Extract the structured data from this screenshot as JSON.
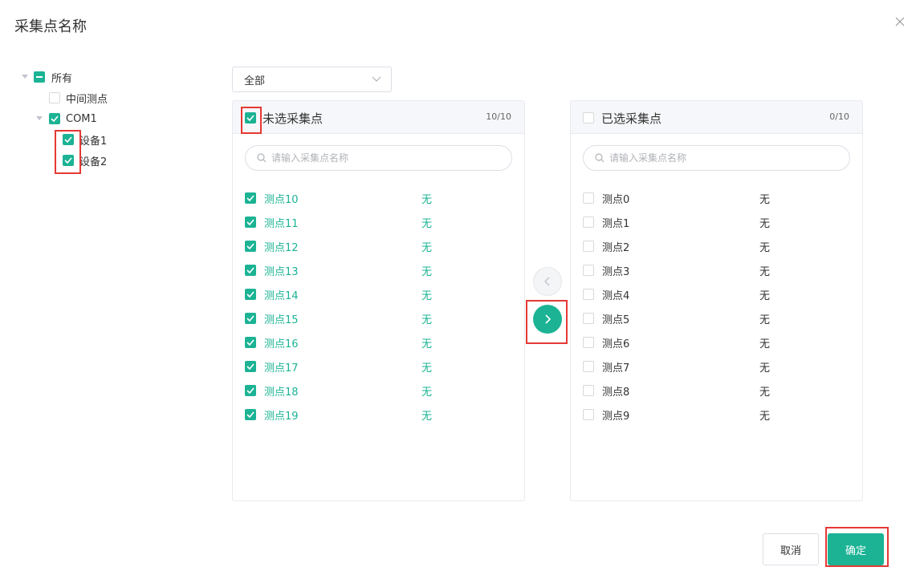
{
  "dialog": {
    "title": "采集点名称"
  },
  "tree": {
    "all_label": "所有",
    "mid_label": "中间测点",
    "com_label": "COM1",
    "device1_label": "设备1",
    "device2_label": "设备2"
  },
  "filter": {
    "selected": "全部"
  },
  "left_panel": {
    "title": "未选采集点",
    "count": "10/10",
    "search_placeholder": "请输入采集点名称",
    "items": [
      {
        "label": "测点10",
        "value": "无"
      },
      {
        "label": "测点11",
        "value": "无"
      },
      {
        "label": "测点12",
        "value": "无"
      },
      {
        "label": "测点13",
        "value": "无"
      },
      {
        "label": "测点14",
        "value": "无"
      },
      {
        "label": "测点15",
        "value": "无"
      },
      {
        "label": "测点16",
        "value": "无"
      },
      {
        "label": "测点17",
        "value": "无"
      },
      {
        "label": "测点18",
        "value": "无"
      },
      {
        "label": "测点19",
        "value": "无"
      }
    ]
  },
  "right_panel": {
    "title": "已选采集点",
    "count": "0/10",
    "search_placeholder": "请输入采集点名称",
    "items": [
      {
        "label": "测点0",
        "value": "无"
      },
      {
        "label": "测点1",
        "value": "无"
      },
      {
        "label": "测点2",
        "value": "无"
      },
      {
        "label": "测点3",
        "value": "无"
      },
      {
        "label": "测点4",
        "value": "无"
      },
      {
        "label": "测点5",
        "value": "无"
      },
      {
        "label": "测点6",
        "value": "无"
      },
      {
        "label": "测点7",
        "value": "无"
      },
      {
        "label": "测点8",
        "value": "无"
      },
      {
        "label": "测点9",
        "value": "无"
      }
    ]
  },
  "footer": {
    "cancel_label": "取消",
    "ok_label": "确定"
  },
  "colors": {
    "accent": "#1bb394",
    "highlight": "#e53935"
  }
}
